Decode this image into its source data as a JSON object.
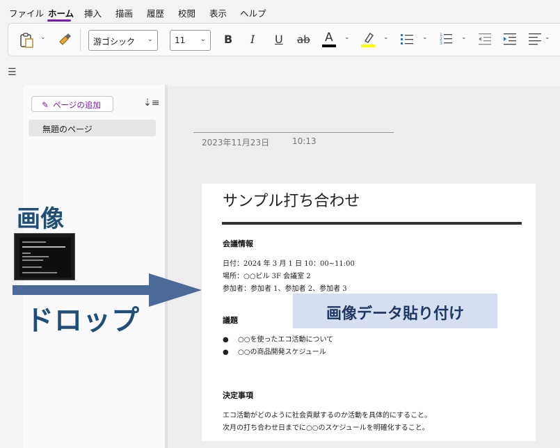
{
  "menu": {
    "items": [
      "ファイル",
      "ホーム",
      "挿入",
      "描画",
      "履歴",
      "校閲",
      "表示",
      "ヘルプ"
    ]
  },
  "ribbon": {
    "font_name": "游ゴシック",
    "font_size": "11",
    "bold": "B",
    "italic": "I",
    "underline": "U",
    "strike": "ab",
    "font_color": "A",
    "font_color_hex": "#000000",
    "highlight_hex": "#ffff00"
  },
  "pages": {
    "add_label": "ページの追加",
    "items": [
      "無題のページ"
    ]
  },
  "note": {
    "date": "2023年11月23日",
    "time": "10:13"
  },
  "doc": {
    "title": "サンプル打ち合わせ",
    "section1": "会議情報",
    "info": [
      "日付：2024 年 3 月 1 日  10：00~11:00",
      "場所：○○ビル  3F   会議室 2",
      "参加者：参加者 1、参加者 2、参加者 3"
    ],
    "section2": "議題",
    "agenda": [
      "○○を使ったエコ活動について",
      "○○の商品開発スケジュール"
    ],
    "section3": "決定事項",
    "decisions": [
      "エコ活動がどのように社会貢献するのか活動を具体的にすること。",
      "次月の打ち合わせ日までに○○のスケジュールを明確化すること。"
    ],
    "bullet": "●"
  },
  "annotation": {
    "image_label": "画像",
    "drop_label": "ドロップ",
    "paste_label": "画像データ貼り付け",
    "arrow_color": "#4a6a9a"
  }
}
